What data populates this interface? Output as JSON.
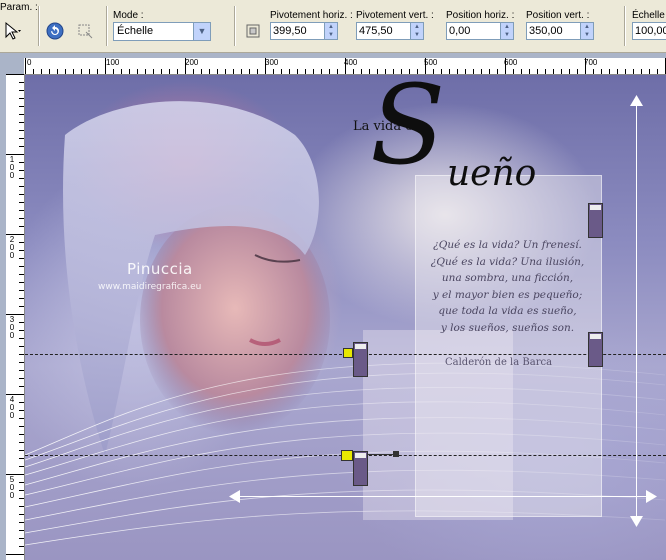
{
  "toolbar": {
    "params_label": "Param. :",
    "mode_label": "Mode :",
    "mode_value": "Échelle",
    "pivot_h_label": "Pivotement horiz. :",
    "pivot_h_value": "399,50",
    "pivot_v_label": "Pivotement vert. :",
    "pivot_v_value": "475,50",
    "pos_h_label": "Position horiz. :",
    "pos_h_value": "0,00",
    "pos_v_label": "Position vert. :",
    "pos_v_value": "350,00",
    "scale_label": "Échelle (",
    "scale_value": "100,00"
  },
  "ruler": {
    "h_ticks": [
      "0",
      "100",
      "200",
      "300",
      "400",
      "500",
      "600",
      "700"
    ],
    "v_ticks": [
      "1\n0\n0",
      "2\n0\n0",
      "3\n0\n0",
      "4\n0\n0",
      "5\n0\n0"
    ]
  },
  "canvas": {
    "title_small": "La vida es",
    "title_big_first": "S",
    "title_big_rest": "ueño",
    "poem_lines": [
      "¿Qué es la vida? Un frenesí.",
      "¿Qué es la vida? Una ilusión,",
      "una sombra, una ficción,",
      "y el mayor bien es pequeño;",
      "que toda la vida es sueño,",
      "y los sueños, sueños son."
    ],
    "poem_author": "Calderón de la Barca",
    "watermark": "Pinuccia",
    "watermark_url": "www.maidiregrafica.eu"
  },
  "colors": {
    "toolbar_bg": "#ece9d8",
    "workspace_bg": "#aab4c8",
    "handle": "#6a5a88"
  }
}
